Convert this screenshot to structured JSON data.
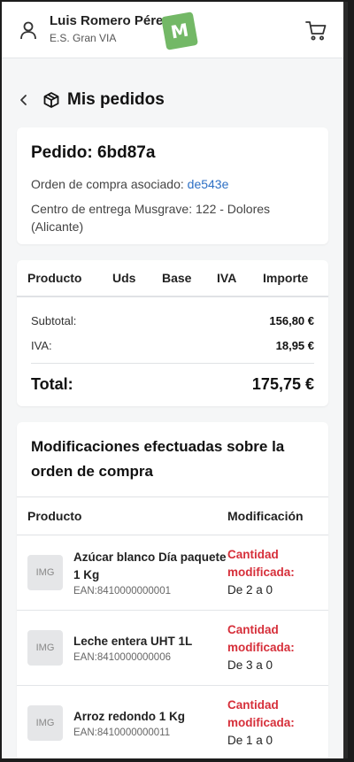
{
  "header": {
    "user_name": "Luis Romero Pérez",
    "store": "E.S. Gran VIA",
    "logo_letter": "M",
    "logo_color": "#73b866"
  },
  "page": {
    "title": "Mis pedidos"
  },
  "order": {
    "title": "Pedido: 6bd87a",
    "po_label": "Orden de compra asociado:",
    "po_link": "de543e",
    "delivery": "Centro de entrega Musgrave: 122 - Dolores (Alicante)"
  },
  "table": {
    "headers": [
      "Producto",
      "Uds",
      "Base",
      "IVA",
      "Importe"
    ]
  },
  "summary": {
    "subtotal_label": "Subtotal:",
    "subtotal_value": "156,80 €",
    "iva_label": "IVA:",
    "iva_value": "18,95 €",
    "total_label": "Total:",
    "total_value": "175,75 €"
  },
  "modifications": {
    "title": "Modificaciones efectuadas sobre la orden de compra",
    "col_product": "Producto",
    "col_mod": "Modificación",
    "rows": [
      {
        "img": "IMG",
        "name": "Azúcar blanco Día paquete 1 Kg",
        "ean": "EAN:8410000000001",
        "label": "Cantidad modificada:",
        "value": "De 2 a 0"
      },
      {
        "img": "IMG",
        "name": "Leche entera UHT 1L",
        "ean": "EAN:8410000000006",
        "label": "Cantidad modificada:",
        "value": "De 3 a 0"
      },
      {
        "img": "IMG",
        "name": "Arroz redondo 1 Kg",
        "ean": "EAN:8410000000011",
        "label": "Cantidad modificada:",
        "value": "De 1 a 0"
      }
    ]
  },
  "colors": {
    "link": "#2c6fc4",
    "modified": "#d62f3a"
  },
  "icons": [
    "user-icon",
    "cart-icon",
    "back-chevron-icon",
    "box-icon"
  ]
}
